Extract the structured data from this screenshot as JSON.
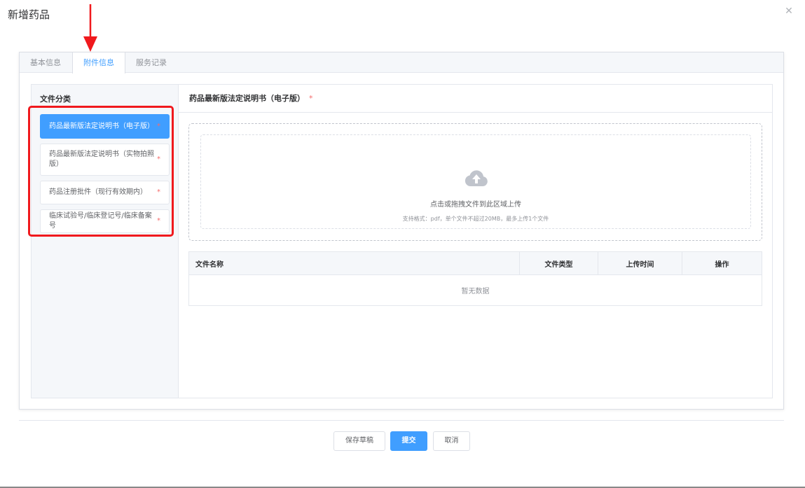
{
  "dialog": {
    "title": "新增药品",
    "close_icon": "close-icon"
  },
  "tabs": [
    {
      "label": "基本信息",
      "active": false
    },
    {
      "label": "附件信息",
      "active": true
    },
    {
      "label": "服务记录",
      "active": false
    }
  ],
  "left_panel": {
    "title": "文件分类",
    "items": [
      {
        "label": "药品最新版法定说明书（电子版）",
        "required": "*",
        "active": true
      },
      {
        "label": "药品最新版法定说明书（实物拍照版）",
        "required": "*",
        "active": false
      },
      {
        "label": "药品注册批件（现行有效期内）",
        "required": "*",
        "active": false
      },
      {
        "label": "临床试验号/临床登记号/临床备案号",
        "required": "*",
        "active": false
      }
    ]
  },
  "right_panel": {
    "title": "药品最新版法定说明书（电子版）",
    "required": "*",
    "upload": {
      "icon": "cloud-upload-icon",
      "text": "点击或拖拽文件到此区域上传",
      "tip": "支持格式：pdf，单个文件不超过20MB，最多上传1个文件"
    },
    "table": {
      "columns": [
        "文件名称",
        "文件类型",
        "上传时间",
        "操作"
      ],
      "empty_text": "暂无数据"
    }
  },
  "footer": {
    "save_draft": "保存草稿",
    "submit": "提交",
    "cancel": "取消"
  },
  "colors": {
    "primary": "#409eff",
    "annotation_red": "#f0191d",
    "required_star": "#f56c6c"
  }
}
